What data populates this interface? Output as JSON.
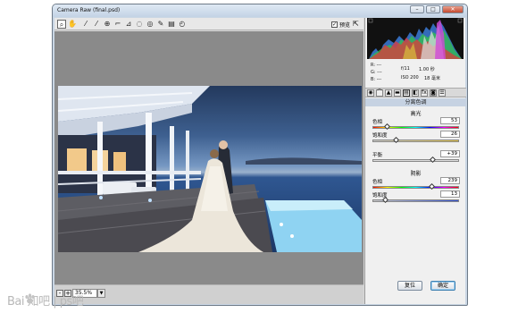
{
  "window": {
    "title": "Camera Raw (final.psd)",
    "minimize": "–",
    "maximize": "□",
    "close": "✕"
  },
  "toolbar": {
    "tools": [
      {
        "name": "zoom-tool-icon",
        "glyph": "⌕"
      },
      {
        "name": "hand-tool-icon",
        "glyph": "✋"
      },
      {
        "name": "white-balance-tool-icon",
        "glyph": "⁄"
      },
      {
        "name": "color-sampler-tool-icon",
        "glyph": "⁄"
      },
      {
        "name": "targeted-adjustment-tool-icon",
        "glyph": "⊕"
      },
      {
        "name": "crop-tool-icon",
        "glyph": "⌐"
      },
      {
        "name": "straighten-tool-icon",
        "glyph": "⊿"
      },
      {
        "name": "spot-removal-tool-icon",
        "glyph": "◌"
      },
      {
        "name": "red-eye-tool-icon",
        "glyph": "◎"
      },
      {
        "name": "adjustment-brush-icon",
        "glyph": "✎"
      },
      {
        "name": "graduated-filter-icon",
        "glyph": "▤"
      },
      {
        "name": "rotate-icon",
        "glyph": "◴"
      }
    ],
    "preview_label": "预览",
    "preview_checked": "✓",
    "fullscreen_glyph": "⇱"
  },
  "status": {
    "zoom_minus": "-",
    "zoom_plus": "+",
    "zoom_value": "35.5%",
    "zoom_arrow": "▼"
  },
  "info": {
    "r": "R: ---",
    "g": "G: ---",
    "b": "B: ---",
    "aperture": "f/11",
    "shutter": "1.00 秒",
    "iso": "ISO 200",
    "focal": "18 毫米"
  },
  "panel": {
    "tabs": [
      "◉",
      "⌒",
      "▲",
      "▬",
      "▤",
      "◧",
      "fx",
      "◙",
      "☰"
    ],
    "section_title": "分离色调",
    "highlights_title": "高光",
    "shadows_title": "阴影",
    "hl_hue_label": "色相",
    "hl_hue_value": "53",
    "hl_sat_label": "饱和度",
    "hl_sat_value": "26",
    "balance_label": "平衡",
    "balance_value": "+39",
    "sh_hue_label": "色相",
    "sh_hue_value": "239",
    "sh_sat_label": "饱和度",
    "sh_sat_value": "13"
  },
  "buttons": {
    "reset": "复位",
    "ok": "确定"
  },
  "watermark": {
    "text": "Bai  知吧 | ps吧"
  }
}
